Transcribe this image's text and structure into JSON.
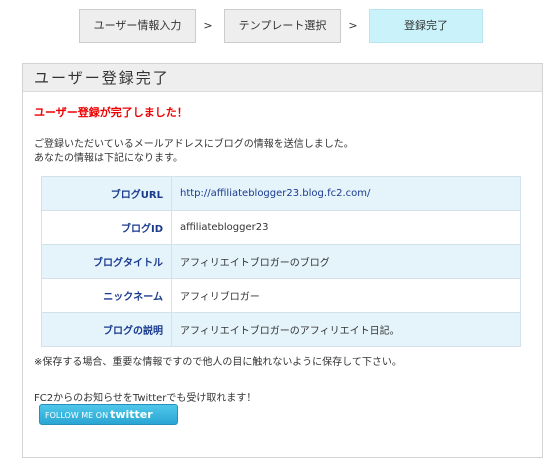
{
  "steps": {
    "step1": "ユーザー情報入力",
    "sep1": ">",
    "step2": "テンプレート選択",
    "sep2": ">",
    "step3": "登録完了"
  },
  "panel": {
    "title": "ユーザー登録完了",
    "success_message": "ユーザー登録が完了しました！",
    "desc_line1": "ご登録いただいているメールアドレスにブログの情報を送信しました。",
    "desc_line2": "あなたの情報は下記になります。"
  },
  "info": [
    {
      "label": "ブログURL",
      "value": "http://affiliateblogger23.blog.fc2.com/"
    },
    {
      "label": "ブログID",
      "value": "affiliateblogger23"
    },
    {
      "label": "ブログタイトル",
      "value": "アフィリエイトブロガーのブログ"
    },
    {
      "label": "ニックネーム",
      "value": "アフィリブロガー"
    },
    {
      "label": "ブログの説明",
      "value": "アフィリエイトブロガーのアフィリエイト日記。"
    }
  ],
  "note": "※保存する場合、重要な情報ですので他人の目に触れないように保存して下さい。",
  "twitter": {
    "text": "FC2からのお知らせをTwitterでも受け取れます！",
    "button_prefix": "FOLLOW ME ON",
    "button_brand": "twitter"
  },
  "colors": {
    "active_step": "#c9f2fb",
    "success": "#ee0000",
    "label_text": "#1a3a8f",
    "row_stripe": "#e5f4fb",
    "twitter_button": "#2aa6d4"
  }
}
